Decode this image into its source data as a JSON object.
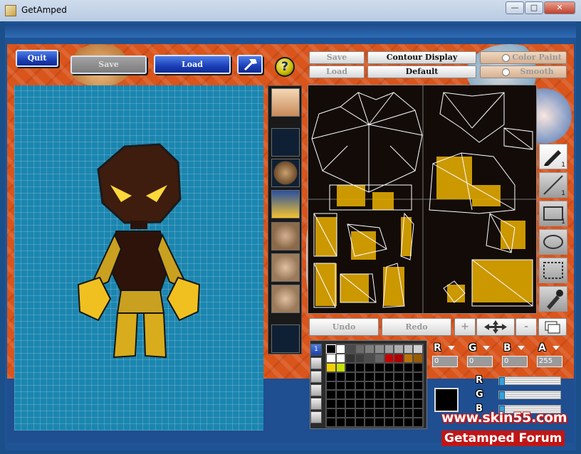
{
  "window": {
    "title": "GetAmped",
    "minimize_label": "—",
    "maximize_label": "□",
    "close_label": "✕"
  },
  "toolbar": {
    "quit_label": "Quit",
    "save_label": "Save",
    "load_label": "Load",
    "help_label": "?"
  },
  "texture_panel": {
    "save_label": "Save",
    "load_label": "Load",
    "contour_display_label": "Contour Display",
    "default_label": "Default",
    "color_paint_label": "Color Paint",
    "smooth_label": "Smooth",
    "undo_label": "Undo",
    "redo_label": "Redo",
    "zoom_in_label": "+",
    "zoom_out_label": "-"
  },
  "tools": [
    {
      "name": "pen",
      "num": "1"
    },
    {
      "name": "line",
      "num": "1"
    },
    {
      "name": "rectangle",
      "num": "1"
    },
    {
      "name": "ellipse",
      "num": ""
    },
    {
      "name": "select",
      "num": ""
    },
    {
      "name": "eyedropper",
      "num": ""
    }
  ],
  "palette": {
    "tab_label": "1",
    "selected_color": "#000000",
    "swatches": [
      "#000000",
      "#ffffff",
      "#4a4a4a",
      "#6a6a6a",
      "#7e7e7e",
      "#8e8e8e",
      "#9e9e9e",
      "#adadad",
      "#bdbdbd",
      "#d0d0d0",
      "#ffffff",
      "#ffffff",
      "#333333",
      "#3d3d3d",
      "#4d4d4d",
      "#666666",
      "#c80000",
      "#b00000",
      "#b8740a",
      "#9a5a00",
      "#f0d000",
      "#c8e000",
      "#000000",
      "#000000",
      "#000000",
      "#000000",
      "#000000",
      "#000000",
      "#000000",
      "#000000",
      "#000000",
      "#000000",
      "#000000",
      "#000000",
      "#000000",
      "#000000",
      "#000000",
      "#000000",
      "#000000",
      "#000000",
      "#000000",
      "#000000",
      "#000000",
      "#000000",
      "#000000",
      "#000000",
      "#000000",
      "#000000",
      "#000000",
      "#000000",
      "#000000",
      "#000000",
      "#000000",
      "#000000",
      "#000000",
      "#000000",
      "#000000",
      "#000000",
      "#000000",
      "#000000",
      "#000000",
      "#000000",
      "#000000",
      "#000000",
      "#000000",
      "#000000",
      "#000000",
      "#000000",
      "#000000",
      "#000000",
      "#000000",
      "#000000",
      "#000000",
      "#000000",
      "#000000",
      "#000000",
      "#000000",
      "#000000",
      "#000000",
      "#000000",
      "#000000",
      "#000000",
      "#000000",
      "#000000",
      "#000000",
      "#000000",
      "#000000",
      "#000000",
      "#000000",
      "#000000"
    ]
  },
  "channels": {
    "r_label": "R",
    "r_value": "0",
    "g_label": "G",
    "g_value": "0",
    "b_label": "B",
    "b_value": "0",
    "a_label": "A",
    "a_value": "255"
  },
  "rgb_side_labels": [
    "R",
    "G",
    "B"
  ],
  "watermark": {
    "url": "www.skin55.com",
    "forum": "Getamped Forum"
  }
}
